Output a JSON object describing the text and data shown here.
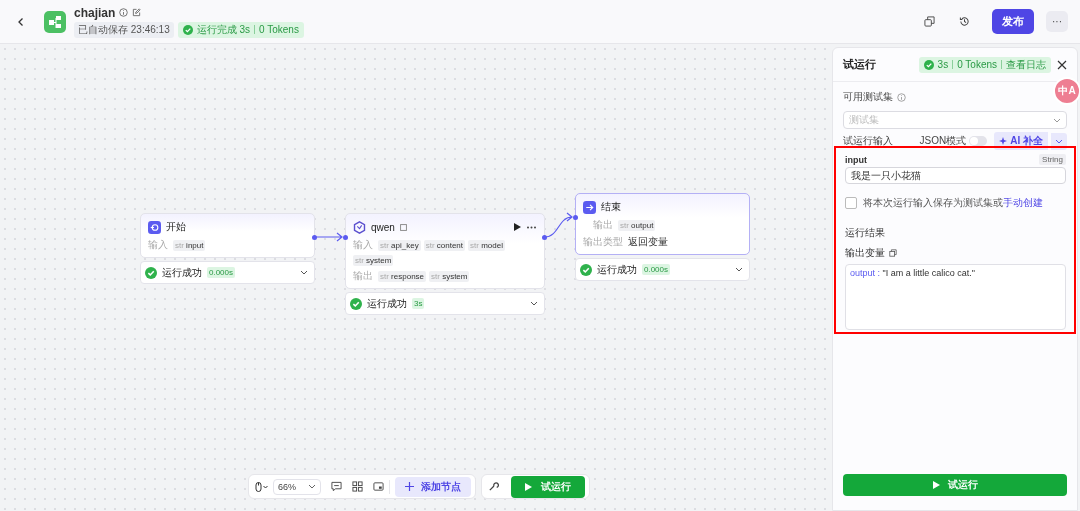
{
  "header": {
    "title": "chajian",
    "autosave": "已自动保存 23:46:13",
    "run_status": {
      "ok": true,
      "text": "运行完成 3s",
      "tokens": "0 Tokens"
    },
    "publish": "发布",
    "more": "···"
  },
  "nodes": [
    {
      "kind": "start",
      "title": "开始",
      "selected": false,
      "rows": [
        {
          "label": "输入",
          "tags": [
            {
              "type": "str",
              "name": "input"
            }
          ]
        }
      ],
      "status": {
        "ok": true,
        "text": "运行成功",
        "time": "0.000s"
      }
    },
    {
      "kind": "llm",
      "title": "qwen",
      "selected": false,
      "rows": [
        {
          "label": "输入",
          "tags": [
            {
              "type": "str",
              "name": "api_key"
            },
            {
              "type": "str",
              "name": "content"
            },
            {
              "type": "str",
              "name": "model"
            },
            {
              "type": "str",
              "name": "system"
            }
          ]
        },
        {
          "label": "输出",
          "tags": [
            {
              "type": "str",
              "name": "response"
            },
            {
              "type": "str",
              "name": "system"
            }
          ]
        }
      ],
      "status": {
        "ok": true,
        "text": "运行成功",
        "time": "3s"
      }
    },
    {
      "kind": "end",
      "title": "结束",
      "selected": true,
      "rows": [
        {
          "label": "输出",
          "tags": [
            {
              "type": "str",
              "name": "output"
            }
          ]
        }
      ],
      "output_type": {
        "label": "输出类型",
        "value": "返回变量"
      },
      "status": {
        "ok": true,
        "text": "运行成功",
        "time": "0.000s"
      }
    }
  ],
  "toolbar": {
    "zoom": "66%",
    "add_node": "添加节点",
    "run": "试运行"
  },
  "panel": {
    "title": "试运行",
    "badge": {
      "ok": true,
      "time": "3s",
      "tokens": "0 Tokens",
      "log": "查看日志"
    },
    "testset_label": "可用测试集",
    "testset_placeholder": "测试集",
    "input_label": "试运行输入",
    "json_mode": {
      "label": "JSON模式",
      "on": false
    },
    "ai_fill": "AI 补全",
    "fields": [
      {
        "name": "input",
        "type": "String",
        "value": "我是一只小花猫"
      }
    ],
    "save": {
      "checked": false,
      "text": "将本次运行输入保存为测试集或",
      "link": "手动创建"
    },
    "result_title": "运行结果",
    "output_title": "输出变量",
    "outputs": [
      {
        "key": "output :",
        "value": "\"I am a little calico cat.\""
      }
    ],
    "run_button": "试运行"
  },
  "translate_badge": "中A"
}
